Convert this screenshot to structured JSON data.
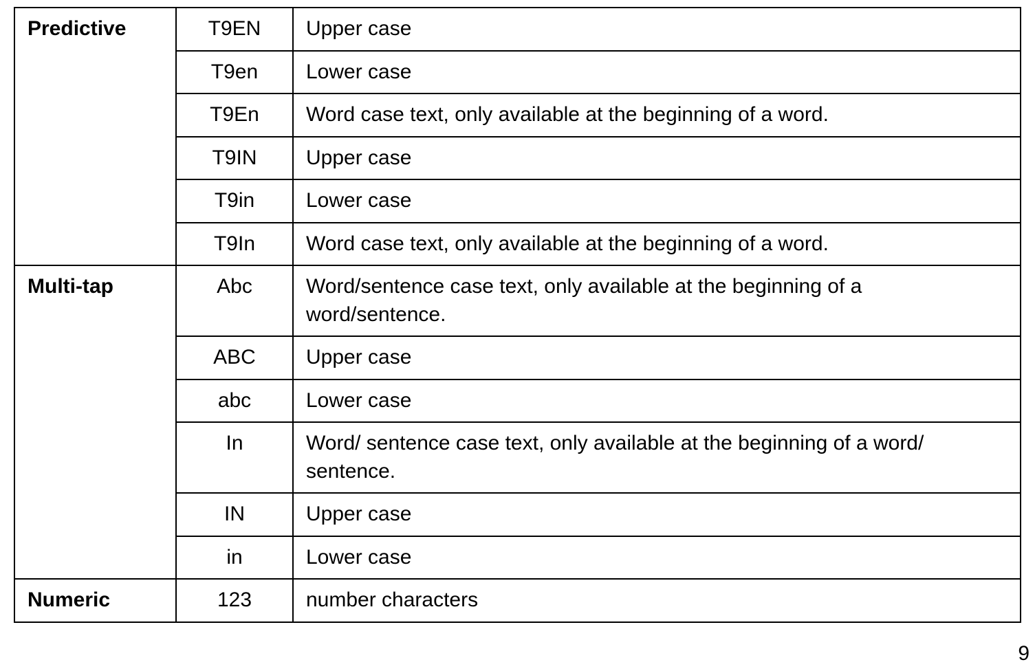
{
  "table": {
    "groups": [
      {
        "name": "Predictive",
        "rows": [
          {
            "code": "T9EN",
            "desc": "Upper case"
          },
          {
            "code": "T9en",
            "desc": "Lower case"
          },
          {
            "code": "T9En",
            "desc": "Word case text, only available at the beginning of a word."
          },
          {
            "code": "T9IN",
            "desc": "Upper case"
          },
          {
            "code": "T9in",
            "desc": "Lower case"
          },
          {
            "code": "T9In",
            "desc": "Word case text, only available at the beginning of a word."
          }
        ]
      },
      {
        "name": "Multi-tap",
        "rows": [
          {
            "code": "Abc",
            "desc": "Word/sentence case text, only available at the beginning of a word/sentence."
          },
          {
            "code": "ABC",
            "desc": "Upper case"
          },
          {
            "code": "abc",
            "desc": "Lower case"
          },
          {
            "code": "In",
            "desc": "Word/ sentence case text, only available at the beginning of a word/ sentence."
          },
          {
            "code": "IN",
            "desc": "Upper case"
          },
          {
            "code": "in",
            "desc": "Lower case"
          }
        ]
      },
      {
        "name": "Numeric",
        "rows": [
          {
            "code": "123",
            "desc": "number characters"
          }
        ]
      }
    ]
  },
  "page_number": "9"
}
